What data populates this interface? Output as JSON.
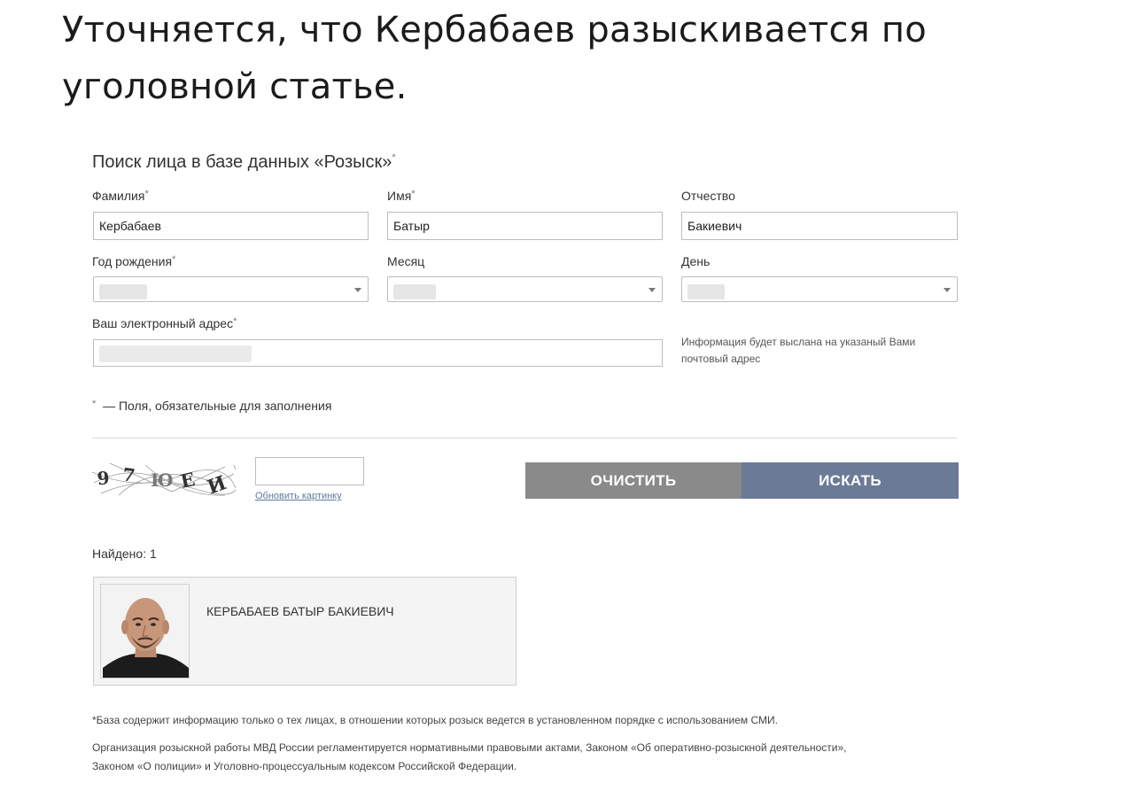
{
  "headline": [
    "Уточняется, что Кербабаев разыскивается по",
    "уголовной статье."
  ],
  "form": {
    "title": "Поиск лица в базе данных «Розыск»",
    "title_mark": "*",
    "required_mark": "*",
    "fields": {
      "surname": {
        "label": "Фамилия",
        "value": "Кербабаев"
      },
      "name": {
        "label": "Имя",
        "value": "Батыр"
      },
      "patronymic": {
        "label": "Отчество",
        "value": "Бакиевич"
      },
      "birth_year": {
        "label": "Год рождения"
      },
      "month": {
        "label": "Месяц"
      },
      "day": {
        "label": "День"
      },
      "email": {
        "label": "Ваш электронный адрес"
      }
    },
    "email_hint": [
      "Информация будет выслана на указаный Вами",
      "почтовый адрес"
    ],
    "required_note_mark": "*",
    "required_note": "— Поля, обязательные для заполнения",
    "captcha": {
      "text": "97ЮЕИ",
      "refresh_label": "Обновить картинку",
      "input_value": ""
    },
    "buttons": {
      "clear": "ОЧИСТИТЬ",
      "search": "ИСКАТЬ"
    }
  },
  "results": {
    "count_text": "Найдено: 1",
    "items": [
      {
        "name": "КЕРБАБАЕВ БАТЫР БАКИЕВИЧ"
      }
    ]
  },
  "footnotes": [
    "*База содержит информацию только о тех лицах, в отношении которых розыск ведется в установленном порядке с использованием СМИ.",
    "Организация розыскной работы МВД России регламентируется нормативными правовыми актами, Законом «Об оперативно-розыскной деятельности»,",
    "Законом «О полиции» и Уголовно-процессуальным кодексом Российской Федерации."
  ],
  "colors": {
    "clear_button": "#8a8a8a",
    "search_button": "#6b7a96",
    "divider": "#d9d9d9"
  }
}
